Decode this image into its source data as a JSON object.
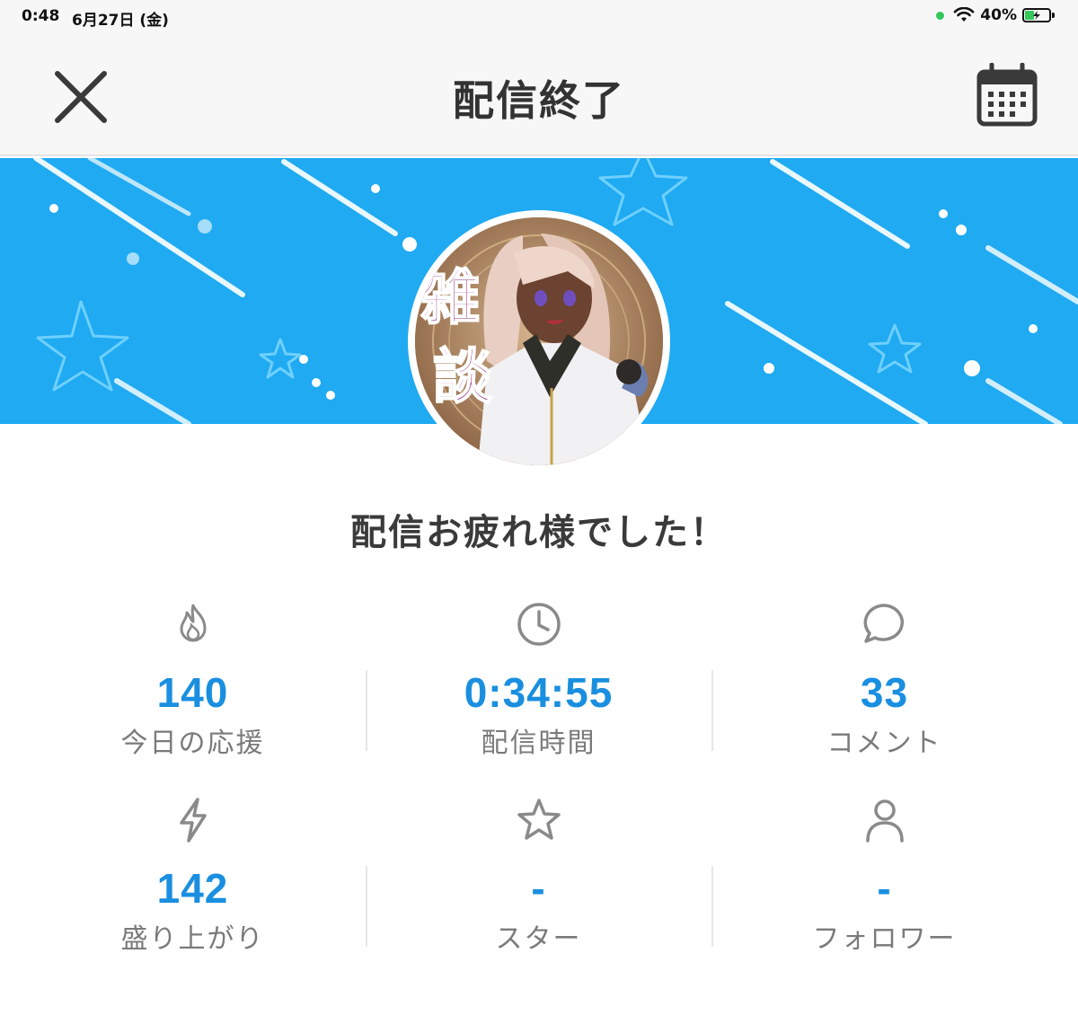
{
  "status_bar": {
    "time": "0:48",
    "date": "6月27日 (金)",
    "battery": "40%",
    "battery_level": 0.4
  },
  "header": {
    "title": "配信終了"
  },
  "avatar": {
    "text": "雑談"
  },
  "message": "配信お疲れ様でした！",
  "stats": [
    {
      "icon": "fire-icon",
      "value": "140",
      "label": "今日の応援"
    },
    {
      "icon": "clock-icon",
      "value": "0:34:55",
      "label": "配信時間"
    },
    {
      "icon": "comment-icon",
      "value": "33",
      "label": "コメント"
    },
    {
      "icon": "lightning-icon",
      "value": "142",
      "label": "盛り上がり"
    },
    {
      "icon": "star-icon",
      "value": "-",
      "label": "スター"
    },
    {
      "icon": "person-icon",
      "value": "-",
      "label": "フォロワー"
    }
  ],
  "colors": {
    "accent": "#1a8fe0",
    "banner": "#1faaf2",
    "label": "#7a7a7a"
  }
}
